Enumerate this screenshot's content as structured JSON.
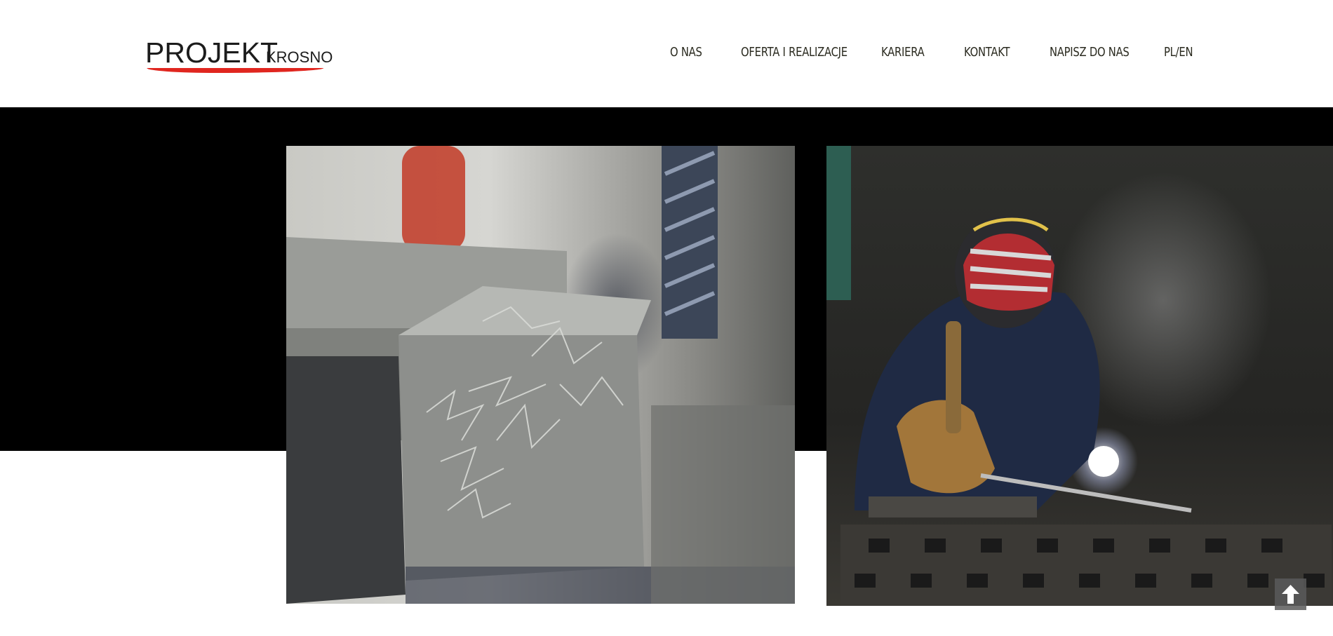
{
  "logo": {
    "main": "PROJEKT",
    "sub": "KROSNO",
    "accent_color": "#e0261f"
  },
  "nav": {
    "items": [
      {
        "label": "O NAS"
      },
      {
        "label": "OFERTA I REALIZACJE"
      },
      {
        "label": "KARIERA"
      },
      {
        "label": "KONTAKT"
      },
      {
        "label": "NAPISZ DO NAS"
      },
      {
        "label": "PL/EN"
      }
    ]
  },
  "hero": {
    "background_color": "#000000",
    "images": [
      {
        "subject": "milling-vise-with-metal-shavings"
      },
      {
        "subject": "welder-at-work"
      }
    ]
  },
  "scroll_top": {
    "icon": "arrow-up-icon"
  }
}
